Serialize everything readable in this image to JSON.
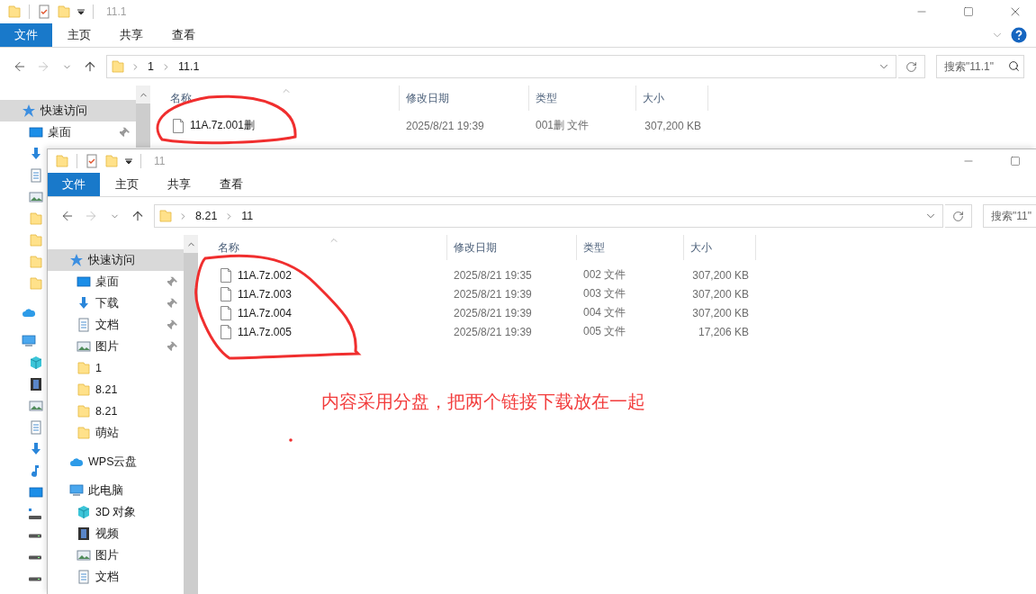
{
  "windows": [
    {
      "title": "11.1",
      "ribbon_tabs": [
        {
          "label": "文件",
          "selected": true
        },
        {
          "label": "主页",
          "selected": false
        },
        {
          "label": "共享",
          "selected": false
        },
        {
          "label": "查看",
          "selected": false
        }
      ],
      "nav_buttons": [
        {
          "kind": "back",
          "disabled": false
        },
        {
          "kind": "forward",
          "disabled": true
        },
        {
          "kind": "recent",
          "disabled": false
        },
        {
          "kind": "up",
          "disabled": false
        }
      ],
      "breadcrumb": [
        "1",
        "11.1"
      ],
      "search": {
        "placeholder": "搜索\"11.1\""
      },
      "nav_pane": [
        {
          "kind": "star",
          "label": "快速访问",
          "selected": true,
          "children": [
            {
              "kind": "desktop",
              "label": "桌面",
              "pinned": true,
              "selected": false
            },
            {
              "kind": "download",
              "selected": false
            },
            {
              "kind": "docs",
              "selected": false
            },
            {
              "kind": "pictures",
              "selected": false
            },
            {
              "kind": "folder",
              "selected": false
            },
            {
              "kind": "folder",
              "selected": false
            },
            {
              "kind": "folder",
              "selected": false
            },
            {
              "kind": "folder",
              "selected": false
            }
          ]
        },
        {
          "kind": "cloud",
          "selected": false
        },
        {
          "kind": "pc",
          "selected": false,
          "children": [
            {
              "kind": "cube",
              "selected": false
            },
            {
              "kind": "video",
              "selected": false
            },
            {
              "kind": "pictures",
              "selected": false
            },
            {
              "kind": "docs",
              "selected": false
            },
            {
              "kind": "download",
              "selected": false
            },
            {
              "kind": "music",
              "selected": false
            },
            {
              "kind": "desktop",
              "selected": false
            },
            {
              "kind": "netdrive",
              "selected": false
            },
            {
              "kind": "drive",
              "selected": false
            },
            {
              "kind": "drive",
              "selected": false
            },
            {
              "kind": "drive",
              "selected": false
            }
          ]
        }
      ],
      "columns": [
        "名称",
        "修改日期",
        "类型",
        "大小"
      ],
      "files": [
        {
          "name": "11A.7z.001删",
          "modified": "2025/8/21 19:39",
          "type": "001删 文件",
          "size": "307,200 KB"
        }
      ]
    },
    {
      "title": "11",
      "ribbon_tabs": [
        {
          "label": "文件",
          "selected": true
        },
        {
          "label": "主页",
          "selected": false
        },
        {
          "label": "共享",
          "selected": false
        },
        {
          "label": "查看",
          "selected": false
        }
      ],
      "nav_buttons": [
        {
          "kind": "back",
          "disabled": false
        },
        {
          "kind": "forward",
          "disabled": true
        },
        {
          "kind": "recent",
          "disabled": false
        },
        {
          "kind": "up",
          "disabled": false
        }
      ],
      "breadcrumb": [
        "8.21",
        "11"
      ],
      "search": {
        "placeholder": "搜索\"11\""
      },
      "nav_pane": [
        {
          "kind": "star",
          "label": "快速访问",
          "selected": true,
          "children": [
            {
              "kind": "desktop",
              "label": "桌面",
              "pinned": true,
              "selected": false
            },
            {
              "kind": "download",
              "label": "下载",
              "pinned": true,
              "selected": false
            },
            {
              "kind": "docs",
              "label": "文档",
              "pinned": true,
              "selected": false
            },
            {
              "kind": "pictures",
              "label": "图片",
              "pinned": true,
              "selected": false
            },
            {
              "kind": "folder",
              "label": "1",
              "selected": false
            },
            {
              "kind": "folder",
              "label": "8.21",
              "selected": false
            },
            {
              "kind": "folder",
              "label": "8.21",
              "selected": false
            },
            {
              "kind": "folder",
              "label": "萌站",
              "selected": false
            }
          ]
        },
        {
          "kind": "cloud",
          "label": "WPS云盘",
          "selected": false
        },
        {
          "kind": "pc",
          "label": "此电脑",
          "selected": false,
          "children": [
            {
              "kind": "cube",
              "label": "3D 对象",
              "selected": false
            },
            {
              "kind": "video",
              "label": "视频",
              "selected": false
            },
            {
              "kind": "pictures",
              "label": "图片",
              "selected": false
            },
            {
              "kind": "docs",
              "label": "文档",
              "selected": false
            }
          ]
        }
      ],
      "columns": [
        "名称",
        "修改日期",
        "类型",
        "大小"
      ],
      "files": [
        {
          "name": "11A.7z.002",
          "modified": "2025/8/21 19:35",
          "type": "002 文件",
          "size": "307,200 KB"
        },
        {
          "name": "11A.7z.003",
          "modified": "2025/8/21 19:39",
          "type": "003 文件",
          "size": "307,200 KB"
        },
        {
          "name": "11A.7z.004",
          "modified": "2025/8/21 19:39",
          "type": "004 文件",
          "size": "307,200 KB"
        },
        {
          "name": "11A.7z.005",
          "modified": "2025/8/21 19:39",
          "type": "005 文件",
          "size": "17,206 KB"
        }
      ]
    }
  ],
  "annotation": {
    "text": "内容采用分盘，把两个链接下载放在一起"
  }
}
